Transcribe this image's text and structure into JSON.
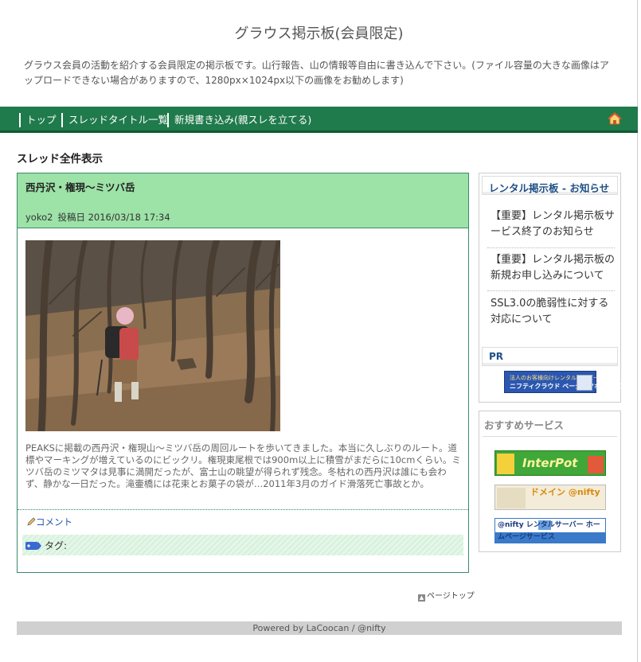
{
  "header": {
    "title": "グラウス掲示板(会員限定)",
    "description": "グラウス会員の活動を紹介する会員限定の掲示板です。山行報告、山の情報等自由に書き込んで下さい。(ファイル容量の大きな画像はアップロードできない場合がありますので、1280px×1024px以下の画像をお勧めします)"
  },
  "nav": {
    "items": [
      "トップ",
      "スレッドタイトル一覧",
      "新規書き込み(親スレを立てる)"
    ],
    "home_icon": "home-icon"
  },
  "main": {
    "section_heading": "スレッド全件表示",
    "thread": {
      "title": "西丹沢・権現～ミツバ岳",
      "author": "yoko2",
      "date": "投稿日 2016/03/18 17:34",
      "body": "PEAKSに掲載の西丹沢・権現山～ミツバ岳の周回ルートを歩いてきました。本当に久しぶりのルート。道標やマーキングが増えているのにビックリ。権現東尾根では900m以上に積雪がまだらに10cmくらい。ミツバ岳のミツマタは見事に満開だったが、富士山の眺望が得られず残念。冬枯れの西丹沢は誰にも会わず、静かな一日だった。滝壷橋には花束とお菓子の袋が…2011年3月のガイド滑落死亡事故とか。",
      "comment_label": "コメント",
      "tag_label": "タグ:"
    },
    "page_top": "ページトップ"
  },
  "sidebar": {
    "notice_title": "レンタル掲示板 - お知らせ",
    "notices": [
      "【重要】レンタル掲示板サービス終了のお知らせ",
      "【重要】レンタル掲示板の新規お申し込みについて",
      "SSL3.0の脆弱性に対する対応について"
    ],
    "pr_title": "PR",
    "pr_banner_line1": "法人のお客様向けレンタルサーバー",
    "pr_banner_line2": "ニフティクラウド ベーシックホスティング",
    "recommend_title": "おすすめサービス",
    "recommend_banners": [
      {
        "text": "InterPot"
      },
      {
        "text": "ドメイン @nifty"
      },
      {
        "text": "@nifty レンタルサーバー ホームページサービス"
      }
    ]
  },
  "footer": {
    "text": "Powered by LaCoocan / @nifty"
  }
}
